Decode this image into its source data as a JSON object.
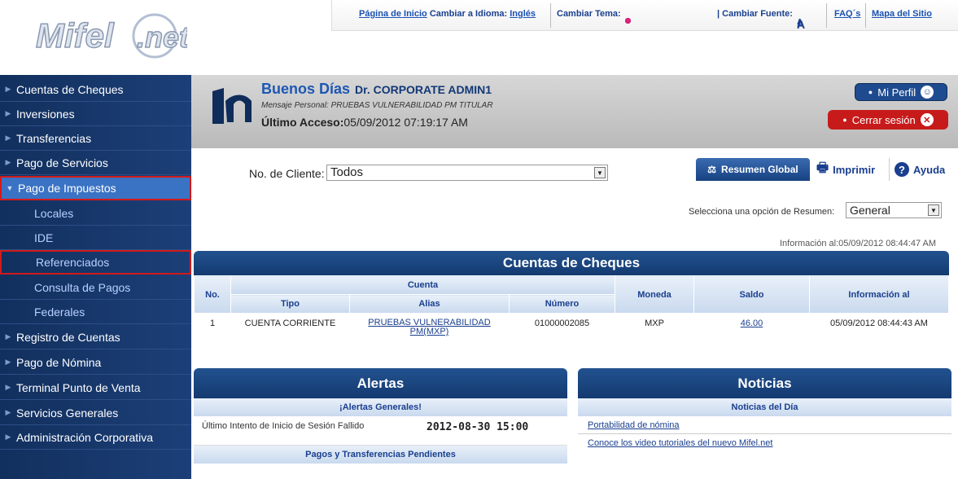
{
  "brand": {
    "logo_text": "Mifel.net"
  },
  "toplinks": {
    "home": "Página de Inicio",
    "change_lang_label": "Cambiar a Idioma:",
    "lang": "Inglés",
    "theme_label": "Cambiar Tema:",
    "theme_colors": [
      "#111111",
      "#1a3f8f",
      "#e0207a"
    ],
    "font_label": "| Cambiar Fuente:",
    "font_sizes": [
      "A",
      "A",
      "A"
    ],
    "faq": "FAQ´s",
    "sitemap": "Mapa del Sitio"
  },
  "sidebar": {
    "items": [
      {
        "label": "Cuentas de Cheques",
        "type": "main"
      },
      {
        "label": "Inversiones",
        "type": "main"
      },
      {
        "label": "Transferencias",
        "type": "main"
      },
      {
        "label": "Pago de Servicios",
        "type": "main"
      },
      {
        "label": "Pago de Impuestos",
        "type": "main-open"
      },
      {
        "label": "Locales",
        "type": "sub"
      },
      {
        "label": "IDE",
        "type": "sub"
      },
      {
        "label": "Referenciados",
        "type": "sub-boxed"
      },
      {
        "label": "Consulta de Pagos",
        "type": "sub"
      },
      {
        "label": "Federales",
        "type": "sub"
      },
      {
        "label": "Registro de Cuentas",
        "type": "main"
      },
      {
        "label": "Pago de Nómina",
        "type": "main"
      },
      {
        "label": "Terminal Punto de Venta",
        "type": "main"
      },
      {
        "label": "Servicios Generales",
        "type": "main"
      },
      {
        "label": "Administración Corporativa",
        "type": "main"
      }
    ]
  },
  "header": {
    "greeting": "Buenos Días",
    "name": "Dr. CORPORATE ADMIN1",
    "message": "Mensaje Personal: PRUEBAS VULNERABILIDAD PM TITULAR",
    "last_access_label": "Último Acceso:",
    "last_access_value": "05/09/2012 07:19:17 AM",
    "profile_button": "Mi Perfil",
    "logout_button": "Cerrar sesión"
  },
  "toolbar": {
    "client_label": "No. de Cliente:",
    "client_value": "Todos",
    "summary_tab": "Resumen Global",
    "print_tab": "Imprimir",
    "help_tab": "Ayuda",
    "summary_option_label": "Selecciona una opción de Resumen:",
    "summary_option_value": "General",
    "info_time": "Información al:05/09/2012 08:44:47 AM"
  },
  "cheques": {
    "title": "Cuentas de Cheques",
    "headers": {
      "no": "No.",
      "cuenta": "Cuenta",
      "tipo": "Tipo",
      "alias": "Alias",
      "numero": "Número",
      "moneda": "Moneda",
      "saldo": "Saldo",
      "info": "Información al"
    },
    "rows": [
      {
        "no": "1",
        "tipo": "CUENTA CORRIENTE",
        "alias": "PRUEBAS VULNERABILIDAD PM(MXP)",
        "numero": "01000002085",
        "moneda": "MXP",
        "saldo": "46.00",
        "info": "05/09/2012 08:44:43 AM"
      }
    ]
  },
  "alertas": {
    "title": "Alertas",
    "subhead": "¡Alertas Generales!",
    "row_label": "Último Intento de Inicio de Sesión Fallido",
    "row_value": "2012-08-30 15:00",
    "subhead2": "Pagos y Transferencias Pendientes"
  },
  "noticias": {
    "title": "Noticias",
    "subhead": "Noticias del Día",
    "items": [
      "Portabilidad de nómina",
      "Conoce los video tutoriales del nuevo Mifel.net"
    ]
  }
}
